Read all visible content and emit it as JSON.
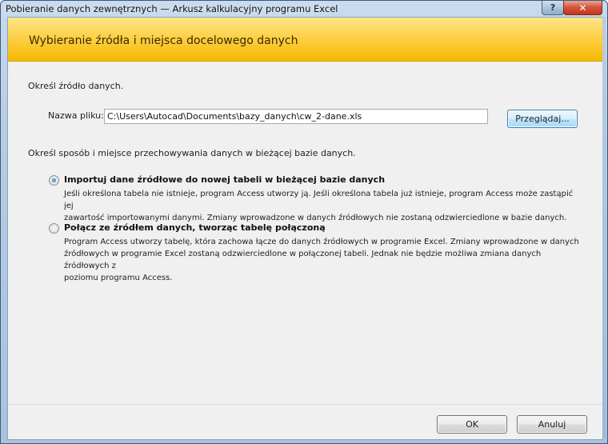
{
  "window": {
    "title": "Pobieranie danych zewnętrznych — Arkusz kalkulacyjny programu Excel",
    "help_label": "?",
    "close_label": "✕"
  },
  "banner": {
    "title": "Wybieranie źródła i miejsca docelowego danych"
  },
  "source": {
    "heading": "Określ źródło danych.",
    "file_label": "Nazwa pliku:",
    "file_value": "C:\\Users\\Autocad\\Documents\\bazy_danych\\cw_2-dane.xls",
    "browse_label": "Przeglądaj..."
  },
  "storage": {
    "heading": "Określ sposób i miejsce przechowywania danych w bieżącej bazie danych.",
    "options": [
      {
        "title": "Importuj dane źródłowe do nowej tabeli w bieżącej bazie danych",
        "checked": true,
        "desc_line1": "Jeśli określona tabela nie istnieje, program Access utworzy ją. Jeśli określona tabela już istnieje, program Access może zastąpić jej",
        "desc_line2": "zawartość importowanymi danymi. Zmiany wprowadzone w danych źródłowych nie zostaną odzwierciedlone w bazie danych."
      },
      {
        "title": "Połącz ze źródłem danych, tworząc tabelę połączoną",
        "checked": false,
        "desc_line1": "Program Access utworzy tabelę, która zachowa łącze do danych źródłowych w programie Excel. Zmiany wprowadzone w danych",
        "desc_line2": "źródłowych w programie Excel zostaną odzwierciedlone w połączonej tabeli. Jednak nie będzie możliwa zmiana danych źródłowych z",
        "desc_line3": "poziomu programu Access."
      }
    ]
  },
  "footer": {
    "ok_label": "OK",
    "cancel_label": "Anuluj"
  }
}
